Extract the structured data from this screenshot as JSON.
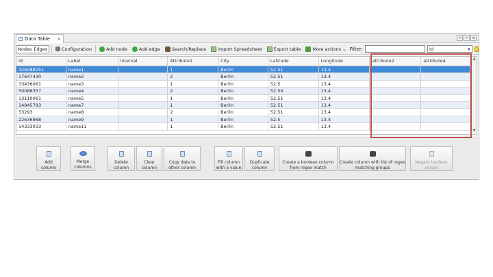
{
  "tab": {
    "title": "Data Table",
    "close": "×"
  },
  "window_nav": {
    "back": "<",
    "forward": ">",
    "menu": "≡"
  },
  "toolbar": {
    "nodes": "Nodes",
    "edges": "Edges",
    "configuration": "Configuration",
    "add_node": "Add node",
    "add_edge": "Add edge",
    "search_replace": "Search/Replace",
    "import_spreadsheet": "Import Spreadsheet",
    "export_table": "Export table",
    "more_actions": "More actions",
    "filter_label": "Filter:",
    "filter_value": "",
    "filter_column": "Id"
  },
  "table": {
    "columns": [
      "Id",
      "Label",
      "Interval",
      "Attribute1",
      "City",
      "Latitude",
      "Longitude",
      "attribute2",
      "attribute4"
    ],
    "rows": [
      [
        "326088251",
        "name1",
        "",
        "1",
        "Berlin",
        "52.51",
        "13.4",
        "",
        ""
      ],
      [
        "17647430",
        "name2",
        "",
        "2",
        "Berlin",
        "52.51",
        "13.4",
        "",
        ""
      ],
      [
        "33436061",
        "name3",
        "",
        "1",
        "Berlin",
        "52.5",
        "13.4",
        "",
        ""
      ],
      [
        "50086357",
        "name4",
        "",
        "2",
        "Berlin",
        "52.50",
        "13.4",
        "",
        ""
      ],
      [
        "13110061",
        "name5",
        "",
        "1",
        "Berlin",
        "52.51",
        "13.4",
        "",
        ""
      ],
      [
        "14845793",
        "name7",
        "",
        "1",
        "Berlin",
        "52.51",
        "13.4",
        "",
        ""
      ],
      [
        "53293",
        "name8",
        "",
        "2",
        "Berlin",
        "52.51",
        "13.4",
        "",
        ""
      ],
      [
        "22636968",
        "name9",
        "",
        "1",
        "Berlin",
        "52.5",
        "13.4",
        "",
        ""
      ],
      [
        "14333033",
        "name11",
        "",
        "1",
        "Berlin",
        "52.51",
        "13.4",
        "",
        ""
      ]
    ]
  },
  "actions": {
    "add_column": "Add column",
    "merge_columns": "Merge columns",
    "delete_column": "Delete column",
    "clear_column": "Clear column",
    "copy_data": "Copy data to other column",
    "fill_column": "Fill column with a value",
    "duplicate_column": "Duplicate column",
    "create_boolean": "Create a boolean column from regex match",
    "create_list": "Create column with list of regex matching groups",
    "negate": "Negate boolean values"
  }
}
